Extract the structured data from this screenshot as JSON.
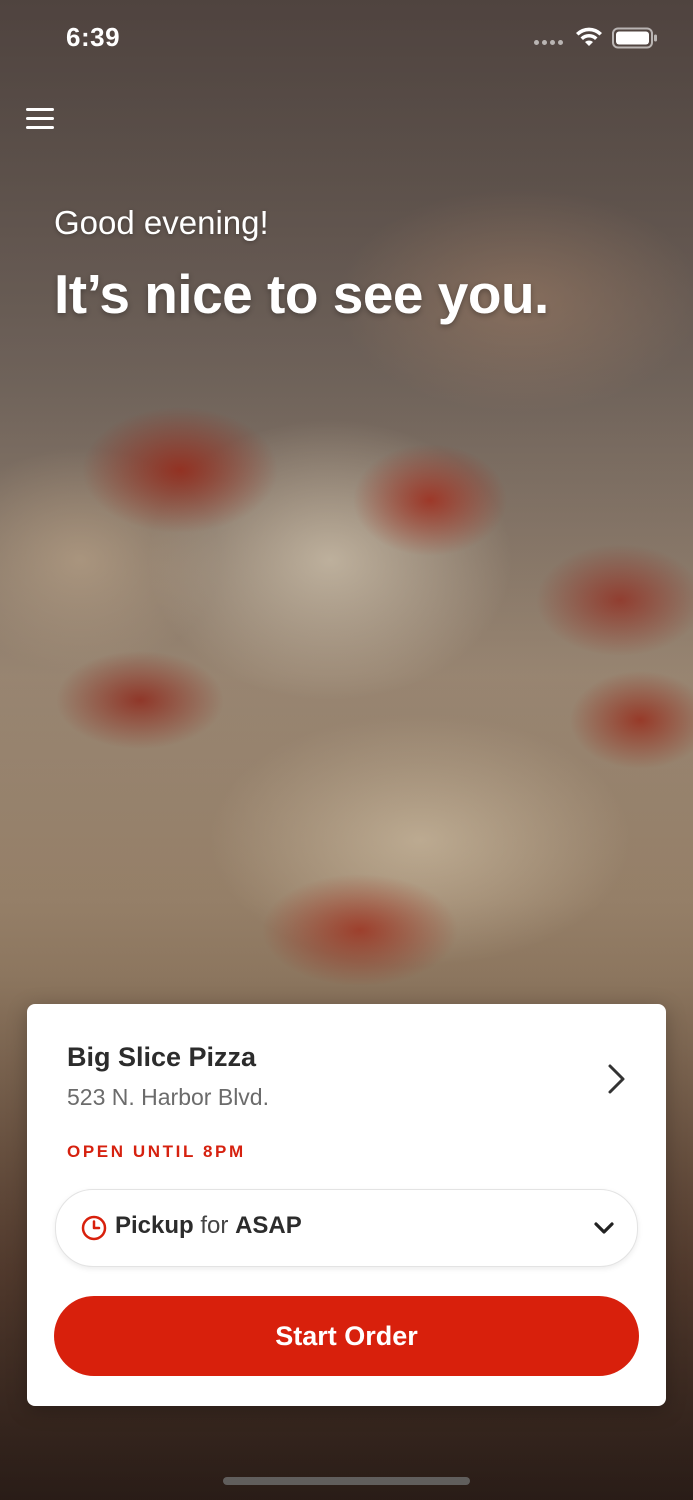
{
  "status_bar": {
    "time": "6:39",
    "wifi_icon": "wifi-icon",
    "battery_icon": "battery-icon"
  },
  "menu": {
    "icon": "hamburger-menu-icon"
  },
  "hero": {
    "greeting": "Good evening!",
    "headline": "It’s nice to see you."
  },
  "store_card": {
    "name": "Big Slice Pizza",
    "address": "523 N. Harbor Blvd.",
    "hours": "OPEN UNTIL 8PM",
    "chevron_icon": "chevron-right-icon"
  },
  "order_mode": {
    "clock_icon": "clock-icon",
    "mode": "Pickup",
    "connector": "for",
    "time": "ASAP",
    "chevron_icon": "chevron-down-icon"
  },
  "cta": {
    "label": "Start Order"
  },
  "colors": {
    "brand_red": "#d8200c",
    "hours_red": "#d6210f",
    "card_background": "#ffffff"
  }
}
